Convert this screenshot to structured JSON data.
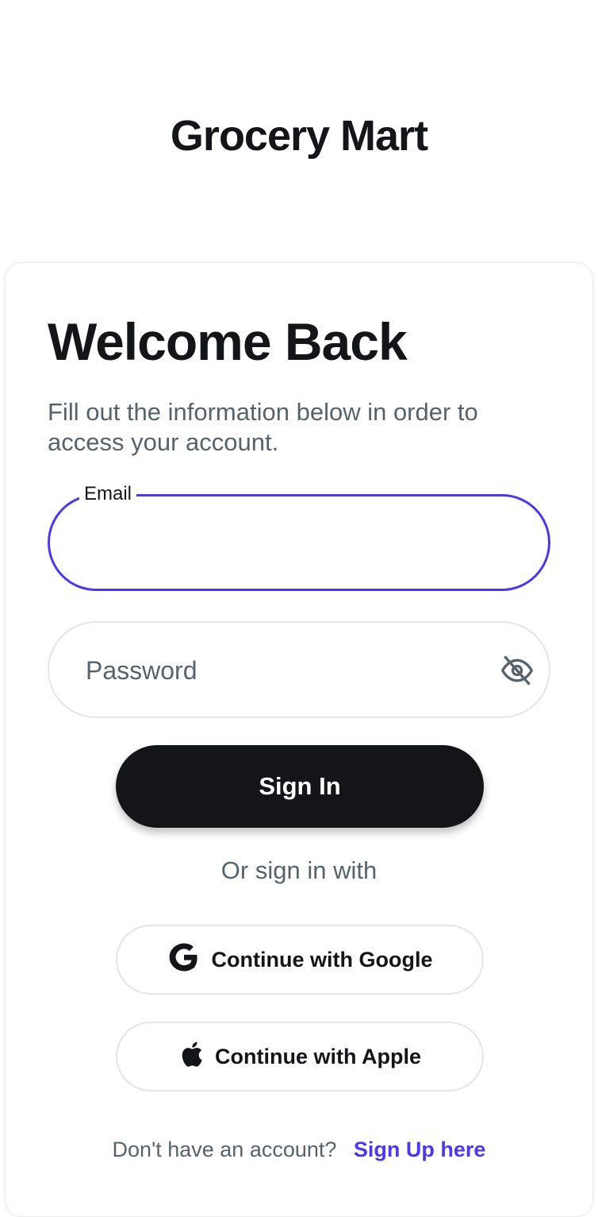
{
  "app": {
    "brand_name": "Grocery Mart"
  },
  "login": {
    "title": "Welcome Back",
    "subtitle": "Fill out the information below in order to access your account.",
    "email": {
      "label": "Email",
      "value": ""
    },
    "password": {
      "placeholder": "Password",
      "value": "",
      "toggle_icon": "eye-off-icon"
    },
    "sign_in_label": "Sign In",
    "divider_text": "Or sign in with",
    "google_label": "Continue with Google",
    "apple_label": "Continue with Apple",
    "signup_prompt": "Don't have an account?",
    "signup_link": "Sign Up here"
  },
  "colors": {
    "primary_text": "#141518",
    "secondary_text": "#57636c",
    "accent": "#4b39ef",
    "button_dark": "#141518",
    "border": "#e3e5e8",
    "background": "#ffffff"
  }
}
